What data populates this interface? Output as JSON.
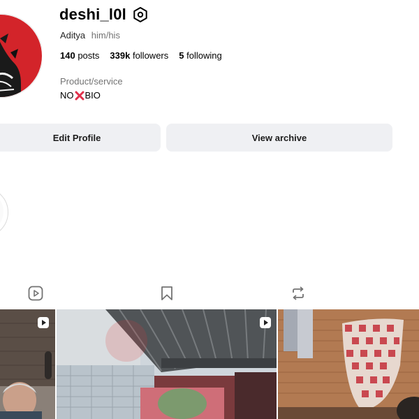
{
  "profile": {
    "username": "deshi_l0l",
    "full_name": "Aditya",
    "pronouns": "him/his",
    "category": "Product/service",
    "bio": {
      "before": "NO",
      "emoji": "cross-mark",
      "after": "BIO"
    }
  },
  "stats": {
    "posts_count": "140",
    "posts_label": "posts",
    "followers_count": "339k",
    "followers_label": "followers",
    "following_count": "5",
    "following_label": "following"
  },
  "actions": {
    "edit_profile": "Edit Profile",
    "view_archive": "View archive"
  },
  "tabs": [
    {
      "icon": "reels-icon"
    },
    {
      "icon": "saved-icon"
    },
    {
      "icon": "tagged-icon"
    }
  ],
  "grid": [
    {
      "type": "reel",
      "subject": "man in front of brick building"
    },
    {
      "type": "reel",
      "subject": "metal roof canopy and cloudy sky"
    },
    {
      "type": "post",
      "subject": "checkered hammock hanging by brick wall"
    }
  ],
  "colors": {
    "button_bg": "#eff0f3",
    "secondary_text": "#737373",
    "avatar_red": "#d3242a",
    "emoji_red": "#e0304a"
  }
}
